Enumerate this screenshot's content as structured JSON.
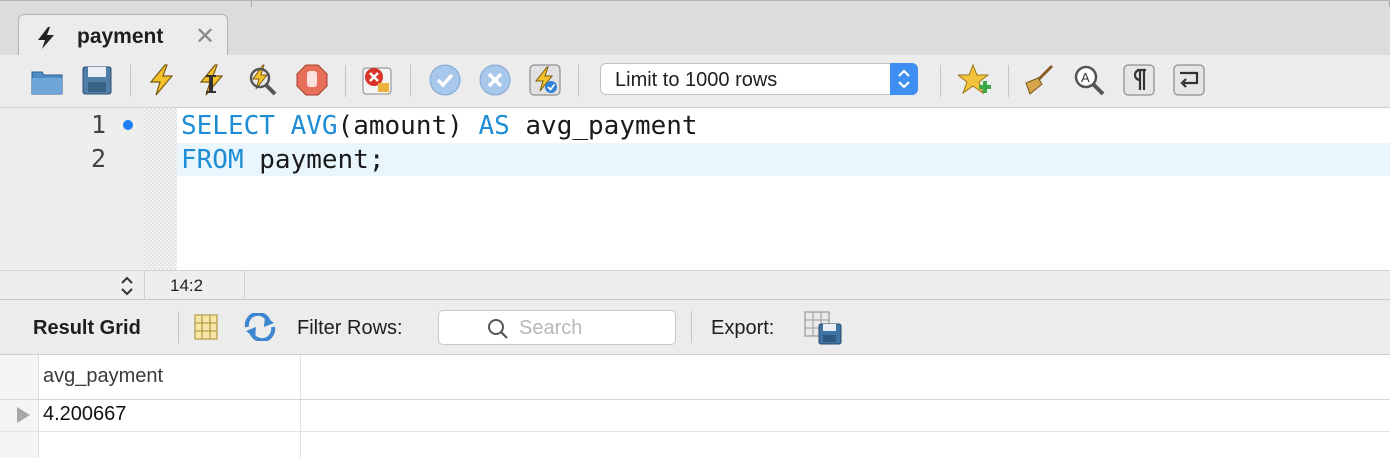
{
  "tab": {
    "title": "payment",
    "close": "✕"
  },
  "toolbar": {
    "limit_value": "Limit to 1000 rows",
    "icons": [
      "open-file-icon",
      "save-icon",
      "execute-icon",
      "execute-current-icon",
      "explain-icon",
      "stop-icon",
      "toggle-error-icon",
      "commit-icon",
      "rollback-icon",
      "autocommit-icon",
      "add-snippet-icon",
      "beautify-icon",
      "find-icon",
      "invisible-chars-icon",
      "word-wrap-icon"
    ]
  },
  "editor": {
    "line_numbers": [
      "1",
      "2"
    ],
    "line1": {
      "kw1": "SELECT",
      "kw2": "AVG",
      "t1": "(amount) ",
      "kw3": "AS",
      "t2": " avg_payment"
    },
    "line2": {
      "kw1": "FROM",
      "t1": " payment;"
    }
  },
  "status": {
    "position": "14:2"
  },
  "results": {
    "title": "Result Grid",
    "filter_label": "Filter Rows:",
    "search_placeholder": "Search",
    "export_label": "Export:",
    "columns": [
      "avg_payment"
    ],
    "rows": [
      [
        "4.200667"
      ]
    ]
  },
  "colors": {
    "keyword": "#1f8dd6",
    "accent": "#3f8ff3",
    "current_line": "#eaf6fd"
  }
}
